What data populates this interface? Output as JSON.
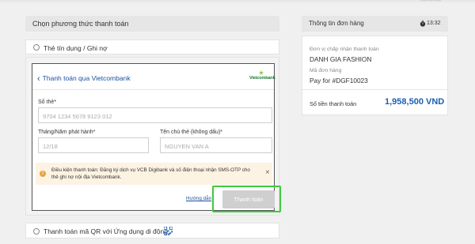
{
  "corner_text": "———",
  "left": {
    "header_title": "Chọn phương thức thanh toán",
    "credit_card_label": "Thẻ tín dụng / Ghi nợ",
    "card_form": {
      "back_title": "Thanh toán qua Vietcombank",
      "bank_logo_text": "Vietcombank",
      "card_number_label": "Số thẻ*",
      "card_number_placeholder": "9704 1234 5678 9123 012",
      "issue_date_label": "Tháng/Năm phát hành*",
      "issue_date_placeholder": "12/18",
      "holder_label": "Tên chủ thẻ (không dấu)*",
      "holder_placeholder": "NGUYEN VAN A",
      "notice_text": "Điều kiện thanh toán: Đăng ký dịch vụ VCB Digibank và số điện thoại nhận SMS-OTP cho thẻ ghi nợ nội địa Vietcombank.",
      "guide_link": "Hướng dẫn",
      "pay_button": "Thanh toán"
    },
    "qr_label": "Thanh toán mã QR với Ứng dụng di động"
  },
  "right": {
    "header_title": "Thông tin đơn hàng",
    "timer": "13:32",
    "merchant_label": "Đơn vị chấp nhận thanh toán",
    "merchant_value": "DANH GIA FASHION",
    "order_label": "Mã đơn hàng",
    "order_value": "Pay for #DGF10023",
    "total_label": "Số tiền thanh toán",
    "total_value": "1,958,500 VND"
  },
  "colors": {
    "accent_blue": "#1a5fb4",
    "highlight_green": "#3ec93e",
    "notice_bg": "#fdf3e3",
    "warning_orange": "#e8a33d",
    "vcb_green": "#1d7a35"
  },
  "icons": {
    "back": "chevron-left-icon",
    "warning": "warning-icon",
    "close": "close-icon",
    "timer": "stopwatch-icon",
    "qr": "qr-code-icon",
    "logo_star": "vietcombank-logo"
  }
}
